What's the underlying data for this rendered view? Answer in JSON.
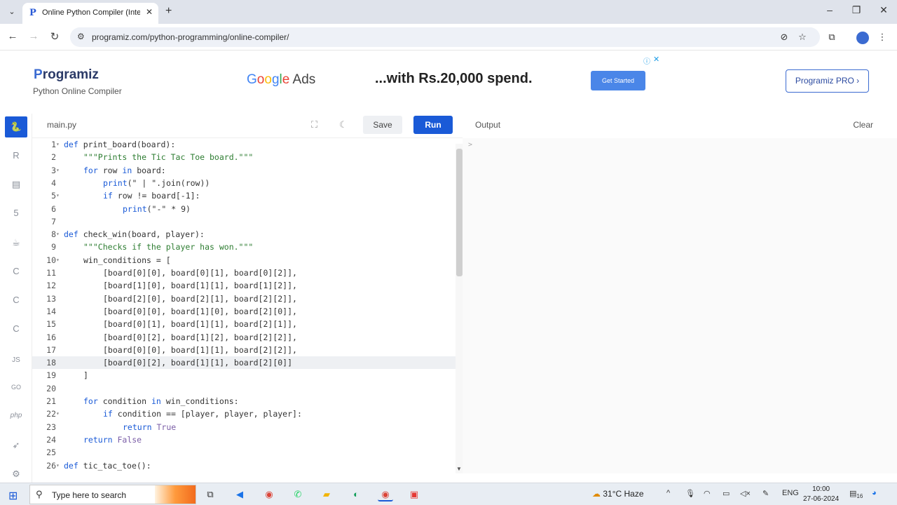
{
  "browser": {
    "tab_title": "Online Python Compiler (Interp",
    "url": "programiz.com/python-programming/online-compiler/"
  },
  "site": {
    "logo_text": "rogramiz",
    "logo_letter": "P",
    "subtitle": "Python Online Compiler",
    "pro_button": "Programiz PRO ›"
  },
  "ad": {
    "brand": "Google Ads",
    "text": "...with Rs.20,000 spend.",
    "cta": "Get Started"
  },
  "editor": {
    "filename": "main.py",
    "save_label": "Save",
    "run_label": "Run",
    "active_line": 18,
    "lines": [
      {
        "n": "1",
        "fold": true,
        "indent": 0,
        "tokens": [
          [
            "kw",
            "def "
          ],
          [
            "",
            "print_board(board):"
          ]
        ]
      },
      {
        "n": "2",
        "fold": false,
        "indent": 1,
        "tokens": [
          [
            "str",
            "\"\"\"Prints the Tic Tac Toe board.\"\"\""
          ]
        ]
      },
      {
        "n": "3",
        "fold": true,
        "indent": 1,
        "tokens": [
          [
            "kw",
            "for "
          ],
          [
            "",
            "row "
          ],
          [
            "kw",
            "in "
          ],
          [
            "",
            "board:"
          ]
        ]
      },
      {
        "n": "4",
        "fold": false,
        "indent": 2,
        "tokens": [
          [
            "kw",
            "print"
          ],
          [
            "",
            "(\" | \".join(row))"
          ]
        ]
      },
      {
        "n": "5",
        "fold": true,
        "indent": 2,
        "tokens": [
          [
            "kw",
            "if "
          ],
          [
            "",
            "row != board[-1]:"
          ]
        ]
      },
      {
        "n": "6",
        "fold": false,
        "indent": 3,
        "tokens": [
          [
            "kw",
            "print"
          ],
          [
            "",
            "(\"-\" * 9)"
          ]
        ]
      },
      {
        "n": "7",
        "fold": false,
        "indent": 0,
        "tokens": []
      },
      {
        "n": "8",
        "fold": true,
        "indent": 0,
        "tokens": [
          [
            "kw",
            "def "
          ],
          [
            "",
            "check_win(board, player):"
          ]
        ]
      },
      {
        "n": "9",
        "fold": false,
        "indent": 1,
        "tokens": [
          [
            "str",
            "\"\"\"Checks if the player has won.\"\"\""
          ]
        ]
      },
      {
        "n": "10",
        "fold": true,
        "indent": 1,
        "tokens": [
          [
            "",
            "win_conditions = ["
          ]
        ]
      },
      {
        "n": "11",
        "fold": false,
        "indent": 2,
        "tokens": [
          [
            "",
            "[board[0][0], board[0][1], board[0][2]],"
          ]
        ]
      },
      {
        "n": "12",
        "fold": false,
        "indent": 2,
        "tokens": [
          [
            "",
            "[board[1][0], board[1][1], board[1][2]],"
          ]
        ]
      },
      {
        "n": "13",
        "fold": false,
        "indent": 2,
        "tokens": [
          [
            "",
            "[board[2][0], board[2][1], board[2][2]],"
          ]
        ]
      },
      {
        "n": "14",
        "fold": false,
        "indent": 2,
        "tokens": [
          [
            "",
            "[board[0][0], board[1][0], board[2][0]],"
          ]
        ]
      },
      {
        "n": "15",
        "fold": false,
        "indent": 2,
        "tokens": [
          [
            "",
            "[board[0][1], board[1][1], board[2][1]],"
          ]
        ]
      },
      {
        "n": "16",
        "fold": false,
        "indent": 2,
        "tokens": [
          [
            "",
            "[board[0][2], board[1][2], board[2][2]],"
          ]
        ]
      },
      {
        "n": "17",
        "fold": false,
        "indent": 2,
        "tokens": [
          [
            "",
            "[board[0][0], board[1][1], board[2][2]],"
          ]
        ]
      },
      {
        "n": "18",
        "fold": false,
        "indent": 2,
        "tokens": [
          [
            "",
            "[board[0][2], board[1][1], board[2][0]]"
          ]
        ]
      },
      {
        "n": "19",
        "fold": false,
        "indent": 1,
        "tokens": [
          [
            "",
            "]"
          ]
        ]
      },
      {
        "n": "20",
        "fold": false,
        "indent": 0,
        "tokens": []
      },
      {
        "n": "21",
        "fold": false,
        "indent": 1,
        "tokens": [
          [
            "kw",
            "for "
          ],
          [
            "",
            "condition "
          ],
          [
            "kw",
            "in "
          ],
          [
            "",
            "win_conditions:"
          ]
        ]
      },
      {
        "n": "22",
        "fold": true,
        "indent": 2,
        "tokens": [
          [
            "kw",
            "if "
          ],
          [
            "",
            "condition == [player, player, player]:"
          ]
        ]
      },
      {
        "n": "23",
        "fold": false,
        "indent": 3,
        "tokens": [
          [
            "kw",
            "return "
          ],
          [
            "cst",
            "True"
          ]
        ]
      },
      {
        "n": "24",
        "fold": false,
        "indent": 1,
        "tokens": [
          [
            "kw",
            "return "
          ],
          [
            "cst",
            "False"
          ]
        ]
      },
      {
        "n": "25",
        "fold": false,
        "indent": 0,
        "tokens": []
      },
      {
        "n": "26",
        "fold": true,
        "indent": 0,
        "tokens": [
          [
            "kw",
            "def "
          ],
          [
            "",
            "tic_tac_toe():"
          ]
        ]
      }
    ]
  },
  "output": {
    "label": "Output",
    "clear_label": "Clear",
    "prompt": ">"
  },
  "rail": {
    "items": [
      "python",
      "r",
      "sql",
      "html",
      "java",
      "c",
      "cpp",
      "csharp",
      "JS",
      "GO",
      "php",
      "swift",
      "rust"
    ]
  },
  "taskbar": {
    "search_placeholder": "Type here to search",
    "weather": "31°C  Haze",
    "lang": "ENG",
    "time": "10:00",
    "date": "27-06-2024",
    "notifications": "16"
  },
  "colors": {
    "accent": "#1a5ad7",
    "keyword": "#1a5ad7",
    "string": "#2e7d32",
    "constant": "#7b5ea7"
  }
}
